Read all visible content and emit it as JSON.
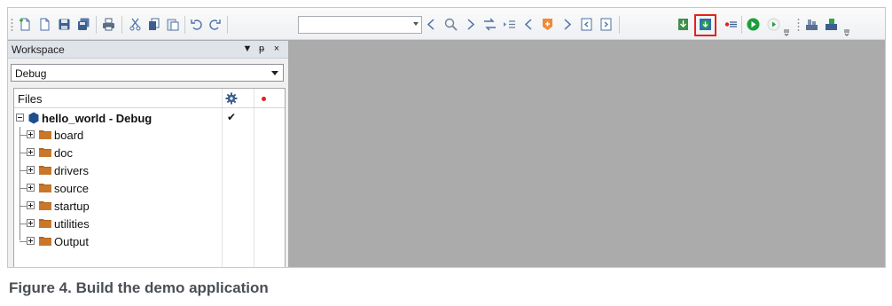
{
  "toolbar": {
    "icons": [
      "new-file-icon",
      "new-workspace-icon",
      "save-icon",
      "save-all-icon",
      "print-icon",
      "cut-icon",
      "copy-icon",
      "paste-icon",
      "undo-icon",
      "redo-icon",
      "back-icon",
      "search-icon",
      "forward-icon",
      "toggle-bookmark-icon",
      "go-to-bookmark-icon",
      "previous-bookmark-icon",
      "breakpoint-icon",
      "next-bookmark-icon",
      "prev-error-icon",
      "next-error-icon",
      "compile-icon",
      "make-icon",
      "stop-build-icon",
      "download-debug-icon",
      "debug-no-download-icon",
      "event-icon",
      "build-all-icon"
    ],
    "highlighted_icon": "make-icon",
    "config_combo_value": ""
  },
  "workspace": {
    "title": "Workspace",
    "pin_glyph": "▼ ⊥ ×",
    "configuration": "Debug"
  },
  "tree": {
    "column_files": "Files",
    "column_settings_icon": "gear-icon",
    "column_breakpoint_icon": "red-dot-icon",
    "project": {
      "name": "hello_world - Debug",
      "check": "✔"
    },
    "folders": [
      "board",
      "doc",
      "drivers",
      "source",
      "startup",
      "utilities",
      "Output"
    ]
  },
  "caption": "Figure 4.  Build the demo application",
  "colors": {
    "highlight": "#e2231a",
    "editor_background": "#ababab",
    "folder": "#b5651d",
    "project_icon": "#1f4e8c"
  }
}
